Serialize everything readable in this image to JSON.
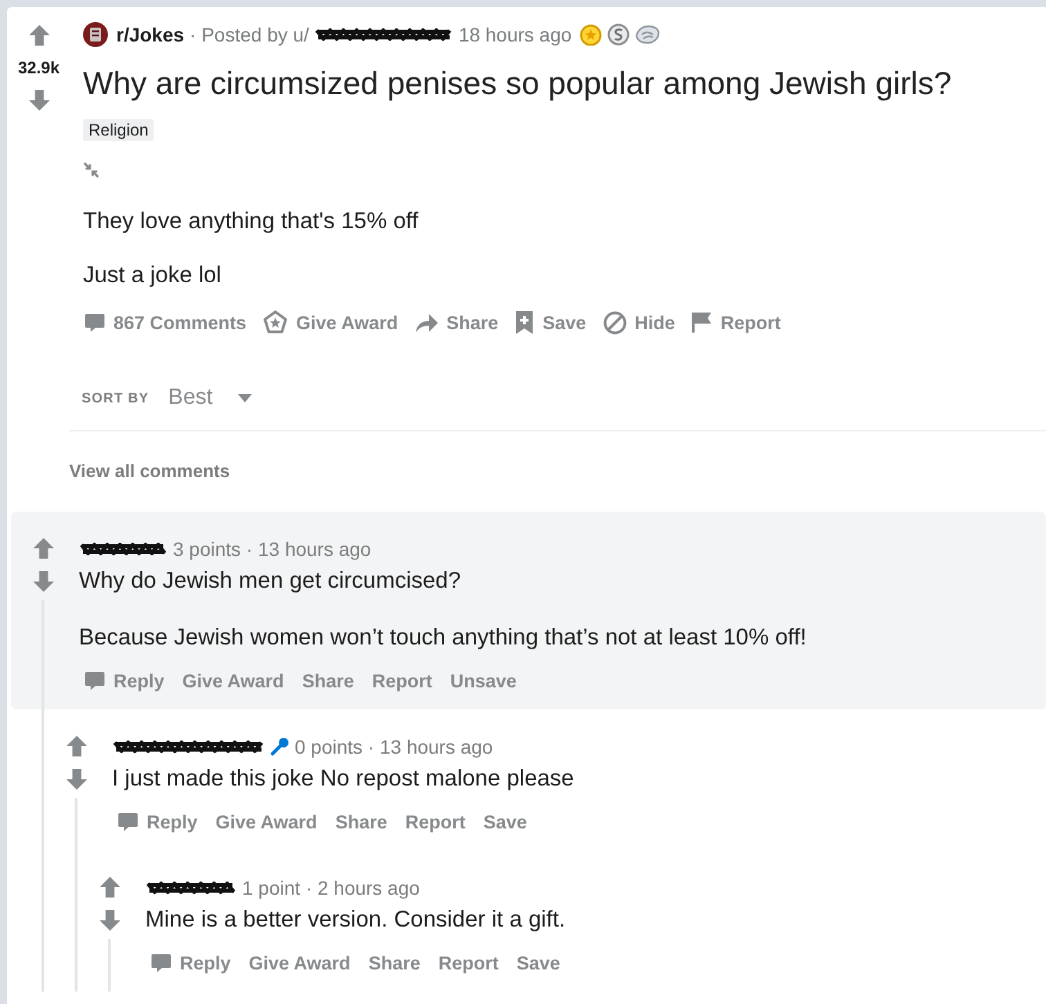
{
  "post": {
    "votes": "32.9k",
    "subreddit": "r/Jokes",
    "posted_by": "· Posted by u/",
    "time": "18 hours ago",
    "awards": [
      {
        "kind": "gold"
      },
      {
        "kind": "silver"
      },
      {
        "kind": "helpful"
      }
    ],
    "title": "Why are circumsized penises so popular among Jewish girls?",
    "flair": "Religion",
    "body": [
      "They love anything that's 15% off",
      "Just a joke lol"
    ],
    "actions": [
      {
        "kind": "comments",
        "label": "867 Comments"
      },
      {
        "kind": "award",
        "label": "Give Award"
      },
      {
        "kind": "share",
        "label": "Share"
      },
      {
        "kind": "save",
        "label": "Save"
      },
      {
        "kind": "hide",
        "label": "Hide"
      },
      {
        "kind": "report",
        "label": "Report"
      }
    ]
  },
  "sort": {
    "label": "SORT BY",
    "value": "Best"
  },
  "view_all": "View all comments",
  "comments": [
    {
      "meta": "3 points · 13 hours ago",
      "highlighted": true,
      "flair_icon": false,
      "body": [
        "Why do Jewish men get circumcised?",
        "Because Jewish women won’t touch anything that’s not at least 10% off!"
      ],
      "actions": [
        {
          "kind": "reply",
          "label": "Reply"
        },
        {
          "kind": "award_text",
          "label": "Give Award"
        },
        {
          "kind": "share_text",
          "label": "Share"
        },
        {
          "kind": "report_text",
          "label": "Report"
        },
        {
          "kind": "unsave",
          "label": "Unsave"
        }
      ],
      "children": [
        {
          "meta": "0 points · 13 hours ago",
          "highlighted": false,
          "flair_icon": true,
          "body": [
            "I just made this joke No repost malone please"
          ],
          "actions": [
            {
              "kind": "reply",
              "label": "Reply"
            },
            {
              "kind": "award_text",
              "label": "Give Award"
            },
            {
              "kind": "share_text",
              "label": "Share"
            },
            {
              "kind": "report_text",
              "label": "Report"
            },
            {
              "kind": "save_text",
              "label": "Save"
            }
          ],
          "children": [
            {
              "meta": "1 point · 2 hours ago",
              "highlighted": false,
              "flair_icon": false,
              "body": [
                "Mine is a better version. Consider it a gift."
              ],
              "actions": [
                {
                  "kind": "reply",
                  "label": "Reply"
                },
                {
                  "kind": "award_text",
                  "label": "Give Award"
                },
                {
                  "kind": "share_text",
                  "label": "Share"
                },
                {
                  "kind": "report_text",
                  "label": "Report"
                },
                {
                  "kind": "save_text",
                  "label": "Save"
                }
              ]
            }
          ]
        }
      ]
    }
  ]
}
